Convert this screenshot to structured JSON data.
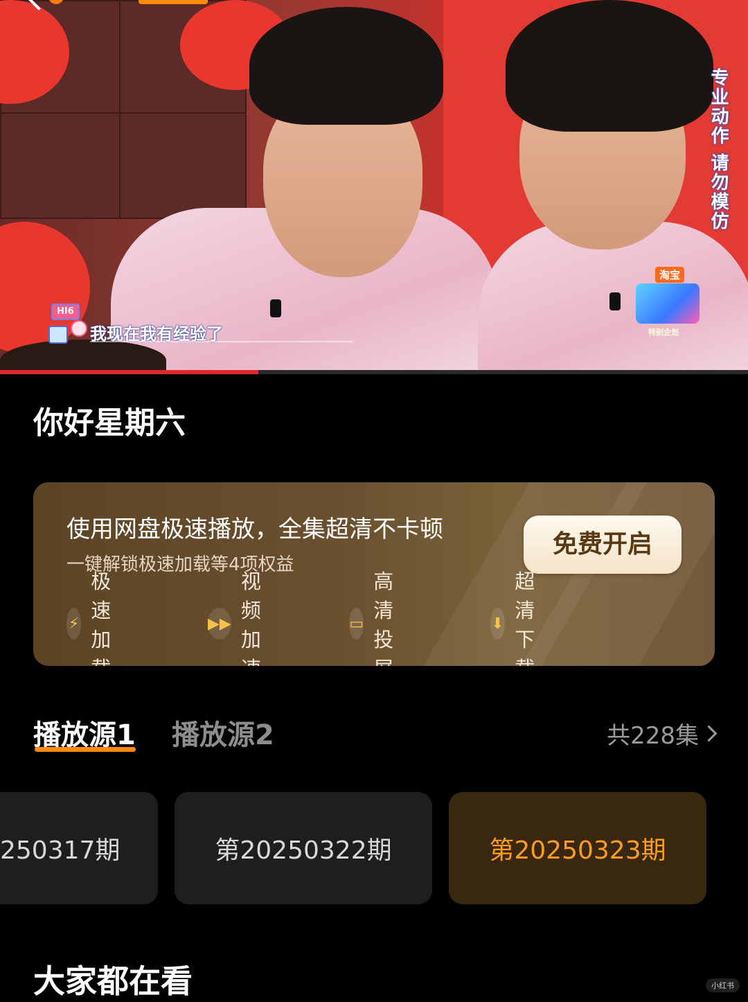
{
  "video": {
    "subtitle_badge": "HI6",
    "subtitle": "我现在我有经验了",
    "watermark": "专业动作 请勿模仿",
    "show_logo_tag": "淘宝",
    "show_logo_sub": "特别企划",
    "progress": 0.345
  },
  "show": {
    "title": "你好星期六"
  },
  "promo": {
    "title": "使用网盘极速播放，全集超清不卡顿",
    "subtitle": "一键解锁极速加载等4项权益",
    "button": "免费开启",
    "benefits": [
      {
        "icon": "lightning-icon",
        "label": "极速加载"
      },
      {
        "icon": "fast-forward-icon",
        "label": "视频加速"
      },
      {
        "icon": "cast-screen-icon",
        "label": "高清投屏"
      },
      {
        "icon": "download-icon",
        "label": "超清下载"
      }
    ]
  },
  "sources": {
    "tabs": [
      "播放源1",
      "播放源2"
    ],
    "active": 0,
    "episode_count": "共228集"
  },
  "episodes": [
    {
      "label": "250317期",
      "selected": false
    },
    {
      "label": "第20250322期",
      "selected": false
    },
    {
      "label": "第20250323期",
      "selected": true
    }
  ],
  "section": {
    "title": "大家都在看"
  },
  "corner_mark": "小红书",
  "colors": {
    "accent": "#ff8a0d",
    "selected_text": "#ff9d1e",
    "progress": "#e02a28"
  }
}
